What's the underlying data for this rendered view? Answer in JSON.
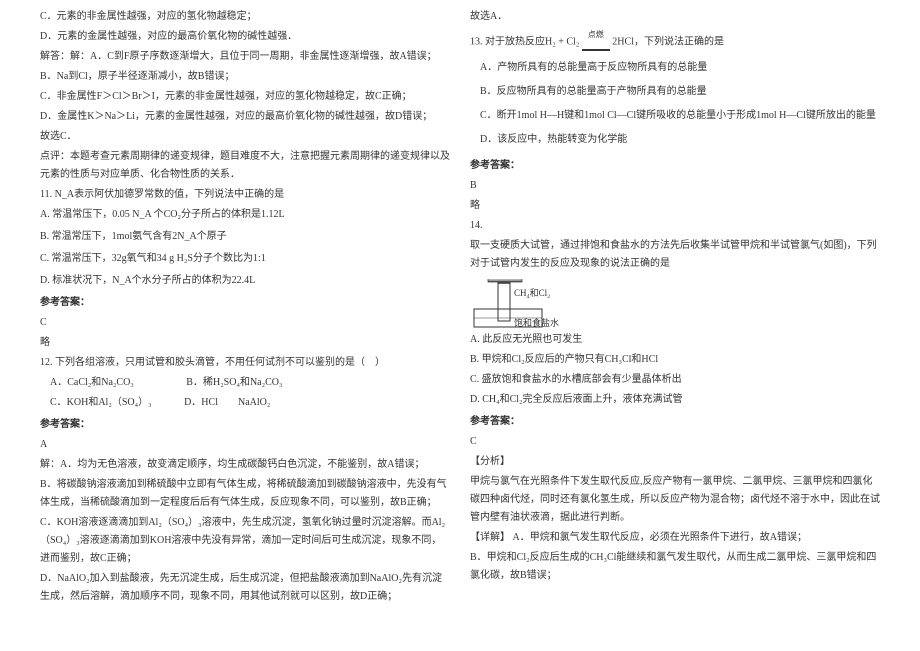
{
  "left": {
    "q10": {
      "optC": "C．元素的非金属性越强，对应的氢化物越稳定；",
      "optD": "D．元素的金属性越强，对应的最高价氧化物的碱性越强．",
      "expl1": "解答：解：A．C到F原子序数逐渐增大，且位于同一周期，非金属性逐渐增强，故A错误；",
      "expl2": "B．Na到Cl，原子半径逐渐减小，故B错误；",
      "expl3": "C．非金属性F＞Cl＞Br＞I，元素的非金属性越强，对应的氢化物越稳定，故C正确；",
      "expl4": "D．金属性K＞Na＞Li，元素的金属性越强，对应的最高价氧化物的碱性越强，故D错误；",
      "expl5": "故选C．",
      "comment": "点评：本题考查元素周期律的递变规律，题目难度不大，注意把握元素周期律的递变规律以及元素的性质与对应单质、化合物性质的关系．"
    },
    "q11": {
      "stem": "11. N_A表示阿伏加德罗常数的值，下列说法中正确的是",
      "optA": "A. 常温常压下，0.05 N_A 个CO₂分子所占的体积是1.12L",
      "optB": "B. 常温常压下，1mol氨气含有2N_A个原子",
      "optC": "C. 常温常压下，32g氧气和34 g H₂S分子个数比为1:1",
      "optD": "D. 标准状况下，N_A个水分子所占的体积为22.4L",
      "ansLabel": "参考答案：",
      "ans": "C",
      "omit": "略"
    },
    "q12": {
      "stem": "12. 下列各组溶液，只用试管和胶头滴管，不用任何试剂不可以鉴别的是（　）",
      "optA": "A．CaCl₂和Na₂CO₃",
      "optB": "B．稀H₂SO₄和Na₂CO₃",
      "optC": "C．KOH和Al₂（SO₄）₃",
      "optD": "D．HCl　　NaAlO₂",
      "ansLabel": "参考答案：",
      "ans": "A",
      "expl1": "解：A．均为无色溶液，故变滴定顺序，均生成碳酸钙白色沉淀，不能鉴别，故A错误；",
      "expl2": "B．将碳酸钠溶液滴加到稀硫酸中立即有气体生成，将稀硫酸滴加到碳酸钠溶液中，先没有气体生成，当稀硫酸滴加到一定程度后后有气体生成，反应现象不同，可以鉴别，故B正确；",
      "expl3": "C．KOH溶液逐滴滴加到Al₂（SO₄）₃溶液中，先生成沉淀，氢氧化钠过量时沉淀溶解。而Al₂（SO₄）₃溶液逐滴滴加到KOH溶液中先没有异常，滴加一定时间后可生成沉淀，现象不同，进而鉴别，故C正确；",
      "expl4": "D．NaAlO₂加入到盐酸液，先无沉淀生成，后生成沉淀，但把盐酸液滴加到NaAlO₂先有沉淀生成，然后溶解，滴加顺序不同，现象不同，用其他试剂就可以区别，故D正确；"
    }
  },
  "right": {
    "q12end": "故选A．",
    "q13": {
      "stem1": "13. 对于放热反应H₂ + Cl₂ ",
      "cond": "点燃",
      "stem2": " 2HCl，下列说法正确的是",
      "optA": "A．产物所具有的总能量高于反应物所具有的总能量",
      "optB": "B．反应物所具有的总能量高于产物所具有的总能量",
      "optC": "C．断开1mol H—H键和1mol Cl—Cl键所吸收的总能量小于形成1mol H—Cl键所放出的能量",
      "optD": "D．该反应中，热能转变为化学能",
      "ansLabel": "参考答案：",
      "ans": "B",
      "omit": "略"
    },
    "q14": {
      "num": "14.",
      "stem": "取一支硬质大试管，通过排饱和食盐水的方法先后收集半试管甲烷和半试管氯气(如图)，下列对于试管内发生的反应及现象的说法正确的是",
      "diagramLabel1": "CH₄和Cl₂",
      "diagramLabel2": "饱和食盐水",
      "optA": "A. 此反应无光照也可发生",
      "optB": "B. 甲烷和Cl₂反应后的产物只有CH₃Cl和HCl",
      "optC": "C. 盛放饱和食盐水的水槽底部会有少量晶体析出",
      "optD": "D. CH₄和Cl₂完全反应后液面上升，液体充满试管",
      "ansLabel": "参考答案：",
      "ans": "C",
      "analysisLabel": "【分析】",
      "analysis": "甲烷与氯气在光照条件下发生取代反应,反应产物有一氯甲烷、二氯甲烷、三氯甲烷和四氯化碳四种卤代烃，同时还有氯化氢生成，所以反应产物为混合物；卤代烃不溶于水中，因此在试管内壁有油状液滴，据此进行判断。",
      "detailLabel": "【详解】",
      "detailA": "A．甲烷和氯气发生取代反应，必须在光照条件下进行，故A错误；",
      "detailB": "B．甲烷和Cl₂反应后生成的CH₃Cl能继续和氯气发生取代，从而生成二氯甲烷、三氯甲烷和四氯化碳，故B错误；"
    }
  }
}
